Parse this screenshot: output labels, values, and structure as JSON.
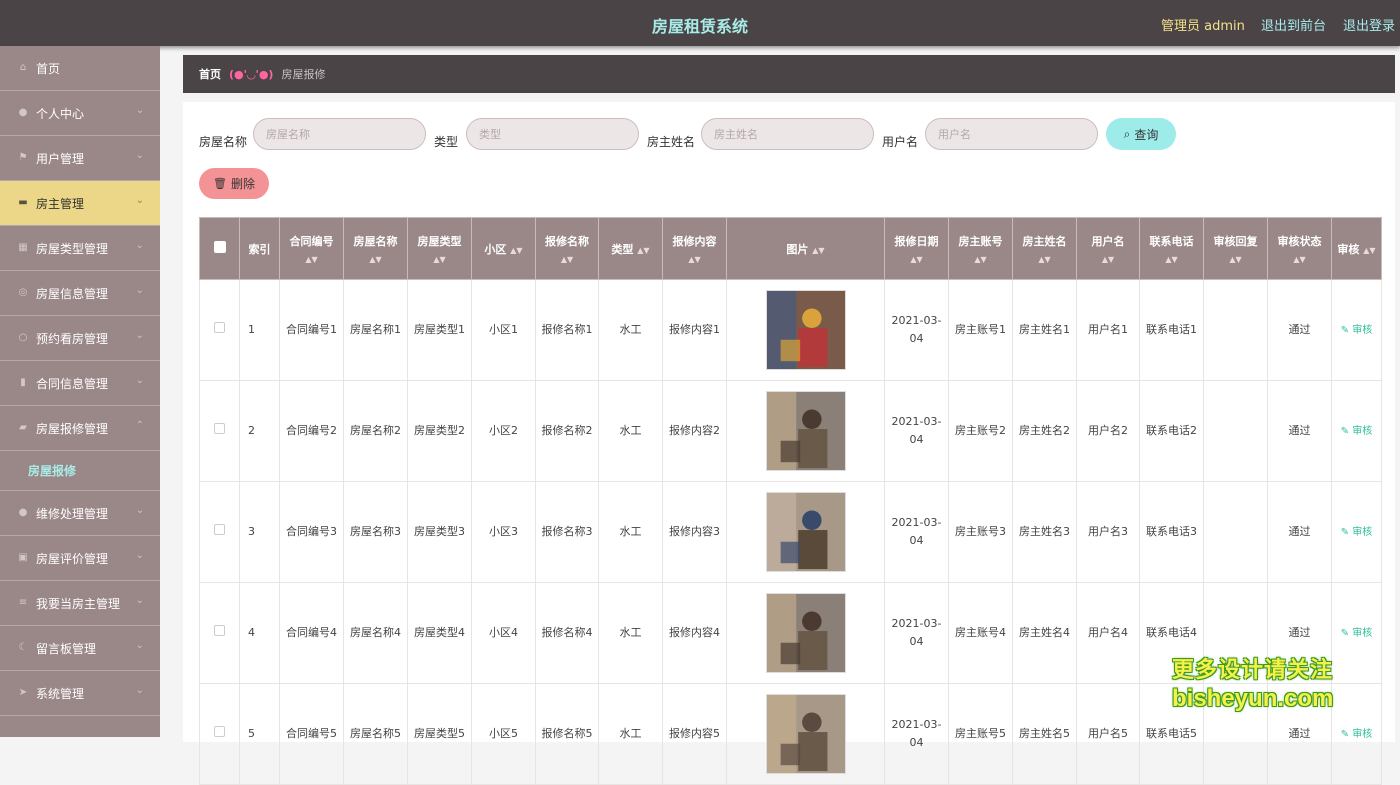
{
  "header": {
    "title": "房屋租赁系统",
    "admin": "管理员 admin",
    "link_front": "退出到前台",
    "link_logout": "退出登录"
  },
  "sidebar": {
    "items": [
      {
        "label": "首页",
        "icon": "home-icon"
      },
      {
        "label": "个人中心",
        "icon": "user-icon"
      },
      {
        "label": "用户管理",
        "icon": "flag-icon"
      },
      {
        "label": "房主管理",
        "icon": "ticket-icon"
      },
      {
        "label": "房屋类型管理",
        "icon": "grid-icon"
      },
      {
        "label": "房屋信息管理",
        "icon": "compass-icon"
      },
      {
        "label": "预约看房管理",
        "icon": "clock-icon"
      },
      {
        "label": "合同信息管理",
        "icon": "chart-icon"
      },
      {
        "label": "房屋报修管理",
        "icon": "chat-icon"
      },
      {
        "label": "维修处理管理",
        "icon": "user-icon"
      },
      {
        "label": "房屋评价管理",
        "icon": "cart-icon"
      },
      {
        "label": "我要当房主管理",
        "icon": "list-icon"
      },
      {
        "label": "留言板管理",
        "icon": "moon-icon"
      },
      {
        "label": "系统管理",
        "icon": "send-icon"
      }
    ],
    "sub_item": "房屋报修"
  },
  "breadcrumb": {
    "home": "首页",
    "separator": "(●'◡'●)",
    "current": "房屋报修"
  },
  "filters": {
    "house_name": {
      "label": "房屋名称",
      "placeholder": "房屋名称"
    },
    "type": {
      "label": "类型",
      "placeholder": "类型"
    },
    "owner_name": {
      "label": "房主姓名",
      "placeholder": "房主姓名"
    },
    "username": {
      "label": "用户名",
      "placeholder": "用户名"
    },
    "query_button": "查询",
    "delete_button": "删除"
  },
  "table": {
    "headers": [
      "索引",
      "合同编号",
      "房屋名称",
      "房屋类型",
      "小区",
      "报修名称",
      "类型",
      "报修内容",
      "图片",
      "报修日期",
      "房主账号",
      "房主姓名",
      "用户名",
      "联系电话",
      "审核回复",
      "审核状态",
      "审核"
    ],
    "rows": [
      {
        "index": "1",
        "contract": "合同编号1",
        "name": "房屋名称1",
        "htype": "房屋类型1",
        "community": "小区1",
        "repair": "报修名称1",
        "type": "水工",
        "content": "报修内容1",
        "date": "2021-03-04",
        "account": "房主账号1",
        "owner": "房主姓名1",
        "user": "用户名1",
        "phone": "联系电话1",
        "reply": "",
        "status": "通过",
        "action": "审核"
      },
      {
        "index": "2",
        "contract": "合同编号2",
        "name": "房屋名称2",
        "htype": "房屋类型2",
        "community": "小区2",
        "repair": "报修名称2",
        "type": "水工",
        "content": "报修内容2",
        "date": "2021-03-04",
        "account": "房主账号2",
        "owner": "房主姓名2",
        "user": "用户名2",
        "phone": "联系电话2",
        "reply": "",
        "status": "通过",
        "action": "审核"
      },
      {
        "index": "3",
        "contract": "合同编号3",
        "name": "房屋名称3",
        "htype": "房屋类型3",
        "community": "小区3",
        "repair": "报修名称3",
        "type": "水工",
        "content": "报修内容3",
        "date": "2021-03-04",
        "account": "房主账号3",
        "owner": "房主姓名3",
        "user": "用户名3",
        "phone": "联系电话3",
        "reply": "",
        "status": "通过",
        "action": "审核"
      },
      {
        "index": "4",
        "contract": "合同编号4",
        "name": "房屋名称4",
        "htype": "房屋类型4",
        "community": "小区4",
        "repair": "报修名称4",
        "type": "水工",
        "content": "报修内容4",
        "date": "2021-03-04",
        "account": "房主账号4",
        "owner": "房主姓名4",
        "user": "用户名4",
        "phone": "联系电话4",
        "reply": "",
        "status": "通过",
        "action": "审核"
      },
      {
        "index": "5",
        "contract": "合同编号5",
        "name": "房屋名称5",
        "htype": "房屋类型5",
        "community": "小区5",
        "repair": "报修名称5",
        "type": "水工",
        "content": "报修内容5",
        "date": "2021-03-04",
        "account": "房主账号5",
        "owner": "房主姓名5",
        "user": "用户名5",
        "phone": "联系电话5",
        "reply": "",
        "status": "通过",
        "action": "审核"
      }
    ]
  },
  "watermark": {
    "line1": "更多设计请关注",
    "line2": "bisheyun.com"
  },
  "colors": {
    "topbar": "#4a4447",
    "sidebar": "#9a8788",
    "active": "#ecd687",
    "accent": "#a8ece8",
    "delete": "#f49395",
    "query": "#9eecea"
  }
}
